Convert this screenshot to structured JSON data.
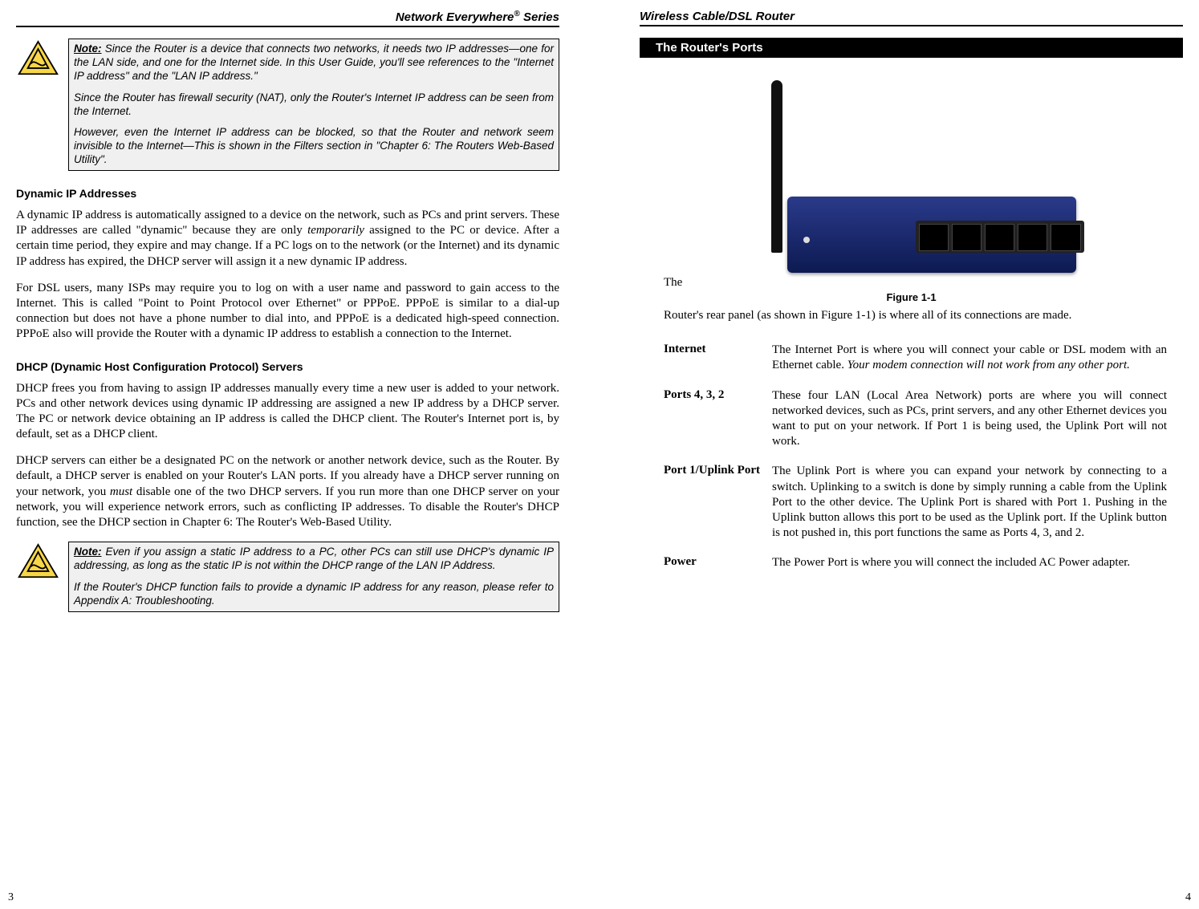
{
  "left_page": {
    "running_head_pre": "Network Everywhere",
    "running_head_sup": "®",
    "running_head_post": " Series",
    "note1": {
      "label": "Note:",
      "p1": " Since the Router is a device that connects two networks, it needs two IP addresses—one for the LAN side, and one for the Internet side.  In this User Guide, you'll see references to the \"Internet IP address\" and the \"LAN IP address.\"",
      "p2": "Since the Router has firewall security (NAT), only the Router's Internet IP address can be seen from the Internet.",
      "p3": "However, even the Internet IP address can be blocked, so that the Router and network seem invisible to the Internet—This is shown in the Filters section in \"Chapter 6: The Routers Web-Based Utility\"."
    },
    "h_dynamic": "Dynamic IP Addresses",
    "p_dyn1_pre": "A dynamic IP address is automatically assigned to a device on the network, such as PCs and print servers.  These IP addresses are called \"dynamic\" because they are only ",
    "p_dyn1_em": "temporarily",
    "p_dyn1_post": " assigned to the PC or device.  After a certain time period, they expire and may change. If a PC logs on to the network (or the Internet) and its dynamic IP address has expired, the DHCP server will assign it a new dynamic IP address.",
    "p_dyn2": "For DSL users, many ISPs may require you to log on with a user name and password to gain access to the Internet. This is called \"Point to Point Protocol over Ethernet\" or PPPoE. PPPoE is similar to a dial-up connection but does not have a phone number to dial into, and PPPoE is a dedicated high-speed connection. PPPoE also will provide the Router with a dynamic IP address to establish a connection to the Internet.",
    "h_dhcp": "DHCP (Dynamic Host Configuration Protocol) Servers",
    "p_dhcp1": "DHCP frees you from having to assign IP addresses manually every time a new user is added to your network. PCs and other network devices using dynamic IP addressing are assigned a new IP address by a DHCP server. The PC or network device obtaining an IP address is called the DHCP client. The Router's Internet port is, by default, set as a DHCP client.",
    "p_dhcp2_pre": "DHCP servers can either be a designated PC on the network or another network device, such as the Router. By default, a DHCP server is enabled on your Router's LAN ports.  If you already have a DHCP server running on your network, you ",
    "p_dhcp2_em": "must",
    "p_dhcp2_post": " disable one of the two DHCP servers.  If you run more than one DHCP server on your network, you will experience network errors, such as conflicting IP addresses.  To disable the Router's DHCP function, see the DHCP section in Chapter 6: The Router's Web-Based Utility.",
    "note2": {
      "label": "Note:",
      "p1": " Even if you assign a static IP address to a PC, other PCs can still use DHCP's dynamic IP addressing, as long as the static IP is not within the DHCP range of the LAN IP Address.",
      "p2": "If the Router's DHCP function fails to provide a dynamic IP address for any reason, please refer to Appendix A: Troubleshooting."
    },
    "page_number": "3"
  },
  "right_page": {
    "running_head": "Wireless Cable/DSL Router",
    "section_title": "The Router's Ports",
    "the_word": "The",
    "fig_caption": "Figure 1-1",
    "intro": "Router's rear panel (as shown in Figure 1-1) is where all of its connections are made.",
    "defs": [
      {
        "term": "Internet",
        "desc_pre": "The Internet Port is where you will connect your cable or DSL modem with an Ethernet cable. ",
        "desc_em": "Your modem connection will not work from any other port.",
        "desc_post": ""
      },
      {
        "term": "Ports 4, 3, 2",
        "desc_pre": "These four LAN (Local Area Network) ports are where you will connect networked devices, such as PCs, print servers, and any other Ethernet devices you want to put on your network. If Port 1 is being used, the Uplink Port will not work.",
        "desc_em": "",
        "desc_post": ""
      },
      {
        "term": "Port 1/Uplink Port",
        "desc_pre": "The Uplink Port is where you can expand your network by connecting to a switch. Uplinking to a switch is done by simply running a cable from the Uplink Port to the other device. The Uplink Port is shared with Port 1. Pushing in the Uplink button allows this port to be used as the Uplink port. If the Uplink button is not pushed in, this port functions the same as Ports 4, 3, and 2.",
        "desc_em": "",
        "desc_post": ""
      },
      {
        "term": "Power",
        "desc_pre": "The Power Port is where you will connect the included AC Power adapter.",
        "desc_em": "",
        "desc_post": ""
      }
    ],
    "page_number": "4"
  }
}
